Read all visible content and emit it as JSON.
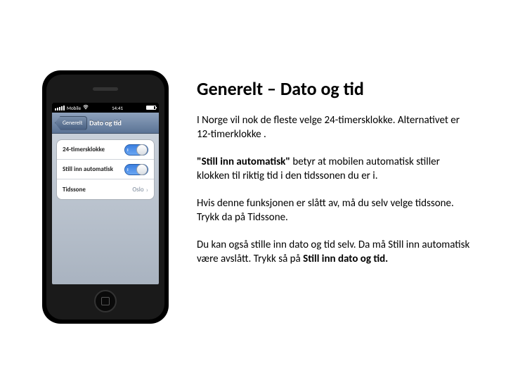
{
  "phone": {
    "status": {
      "carrier": "Mobile",
      "wifi_icon": "wifi",
      "time": "14:41"
    },
    "nav": {
      "back_label": "Generelt",
      "title": "Dato og tid"
    },
    "rows": {
      "clock24": {
        "label": "24-timersklokke"
      },
      "auto": {
        "label": "Still inn automatisk"
      },
      "tz": {
        "label": "Tidssone",
        "value": "Oslo"
      }
    }
  },
  "text": {
    "heading": "Generelt – Dato og tid",
    "p1": "I Norge vil nok de fleste velge  24-timersklokke. Alternativet er 12-timerklokke .",
    "p2_bold": "\"Still inn automatisk\"",
    "p2_rest": " betyr at mobilen automatisk stiller klokken til riktig tid i den tidssonen du er i.",
    "p3": "Hvis denne funksjonen er slått av, må du selv velge tidssone. Trykk da på Tidssone.",
    "p4a": "Du kan også stille inn dato og tid selv. Da må Still inn automatisk være avslått. Trykk så på ",
    "p4b_bold": "Still inn dato og tid.",
    "p4c": ""
  }
}
